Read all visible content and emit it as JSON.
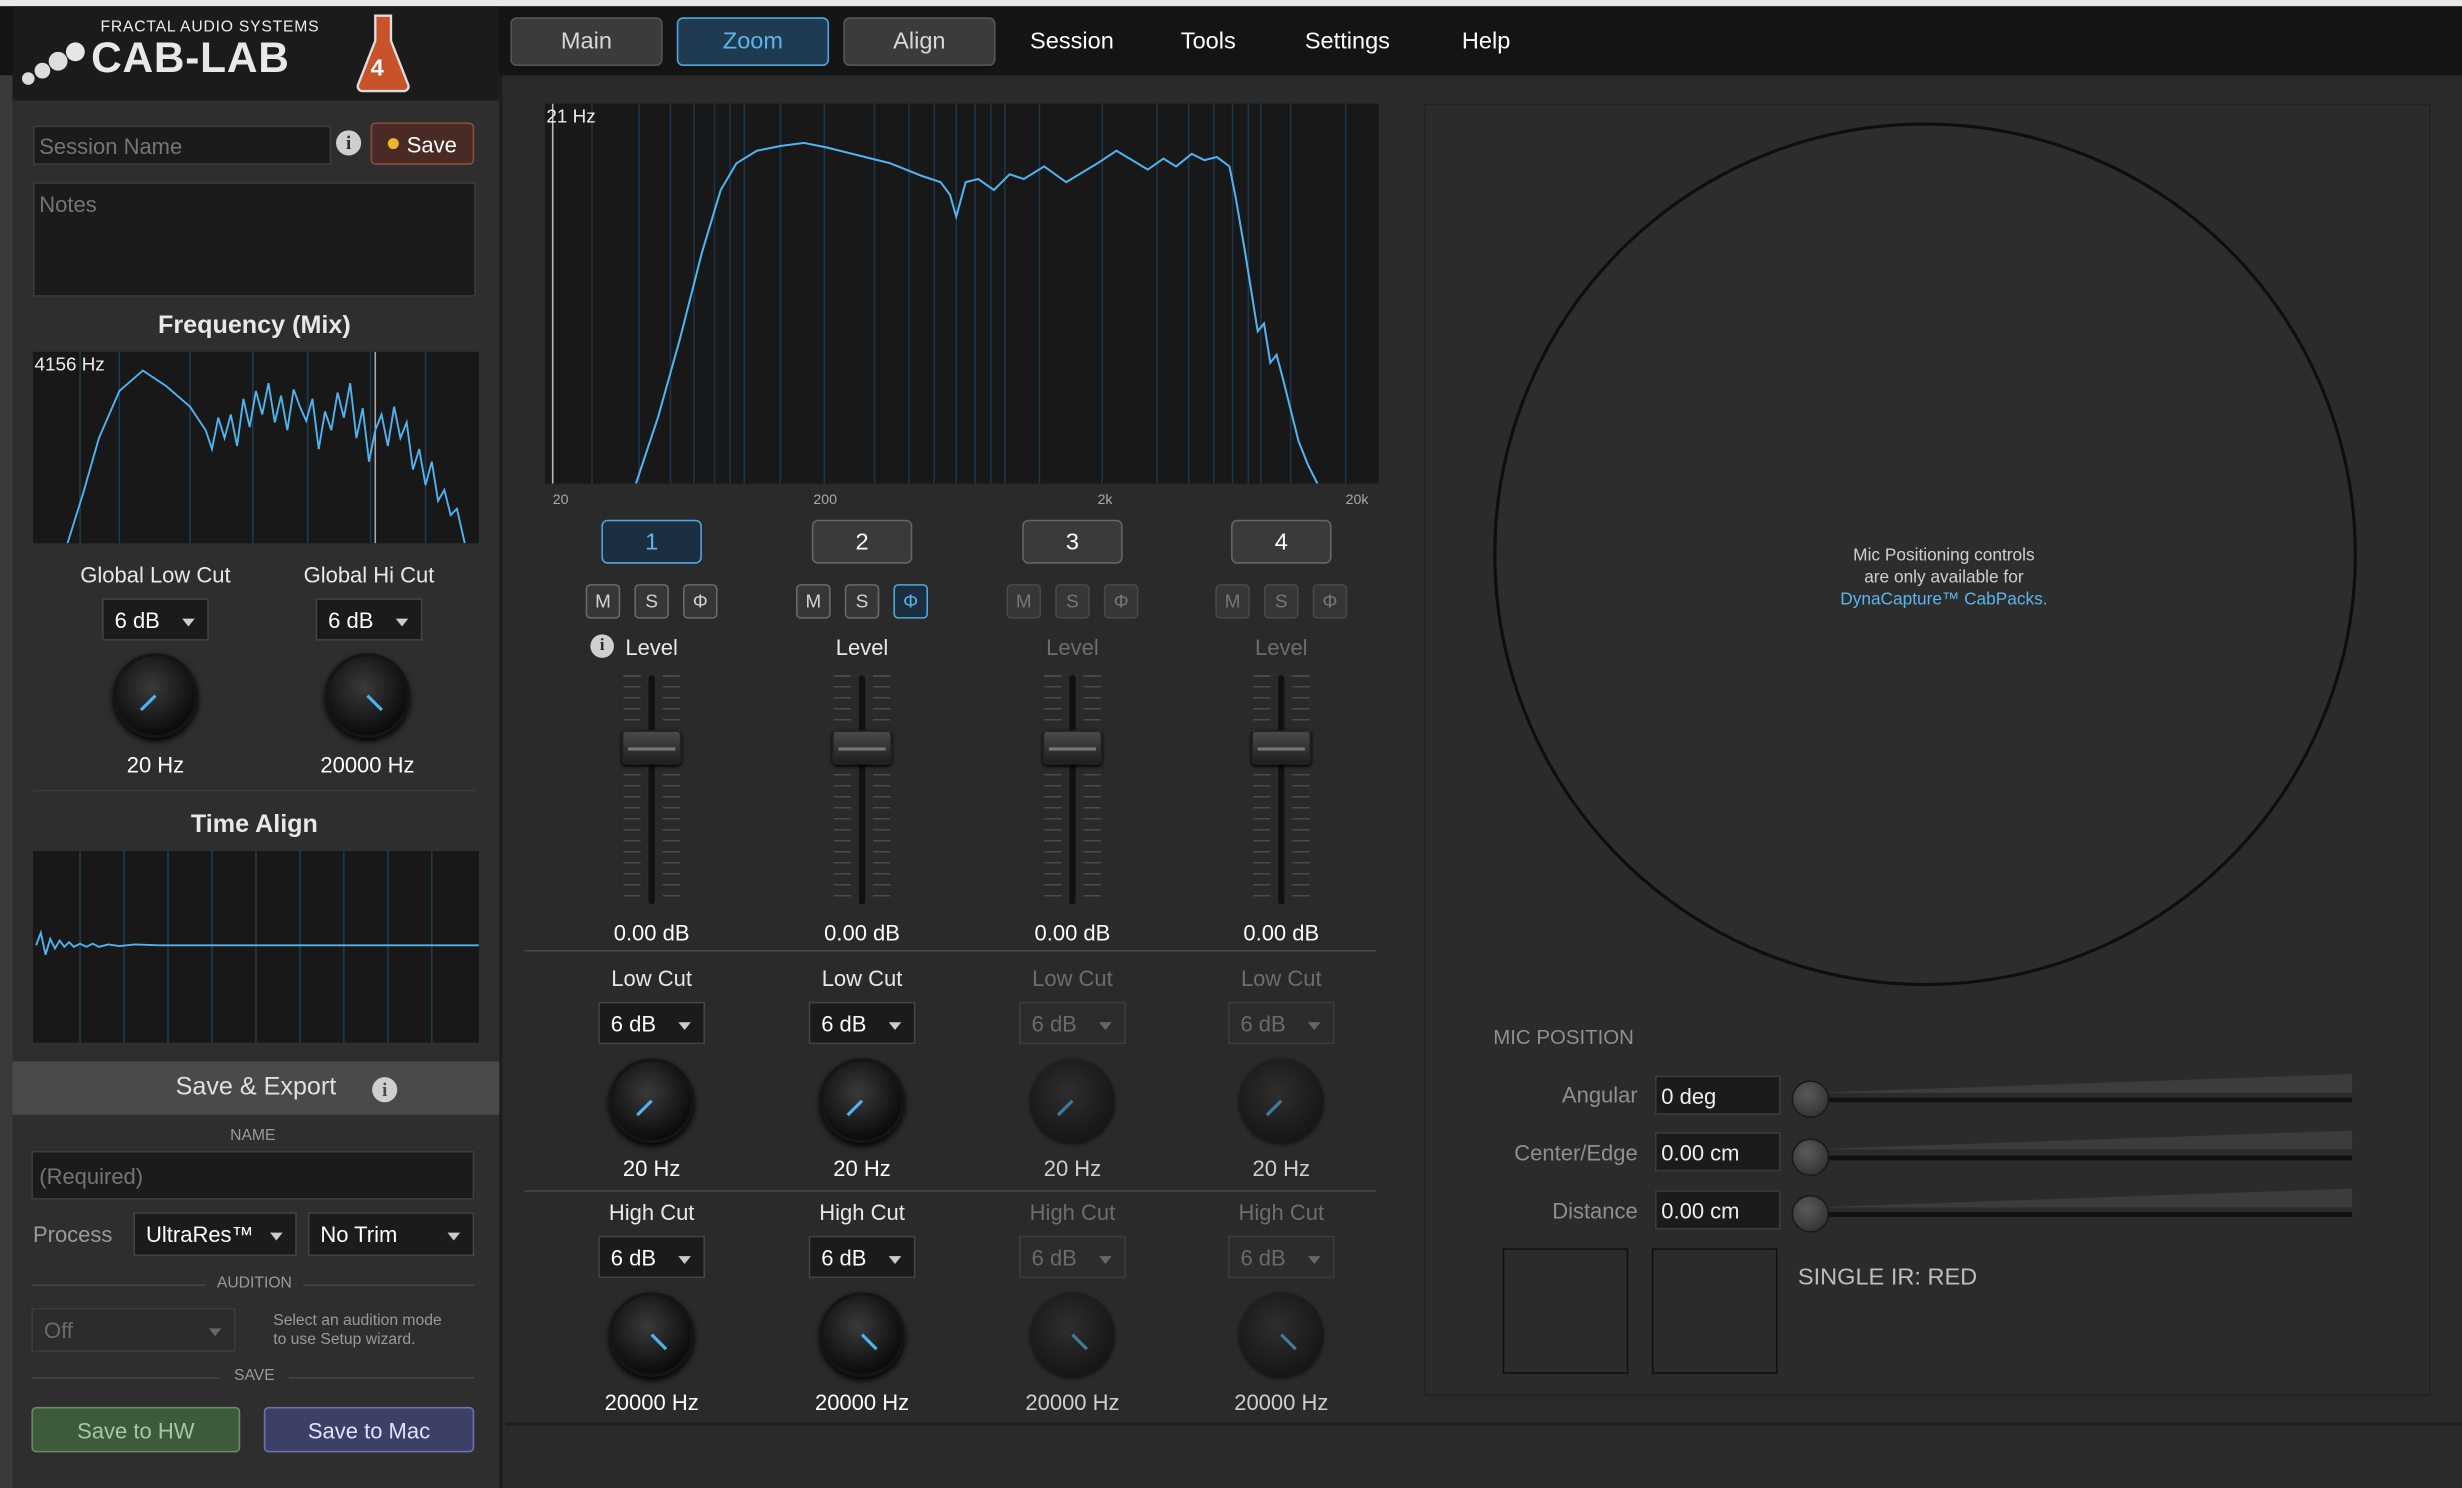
{
  "app": {
    "brand": "FRACTAL AUDIO SYSTEMS",
    "name": "CAB-LAB",
    "version": "4"
  },
  "nav": {
    "tabs": [
      {
        "label": "Main",
        "active": false
      },
      {
        "label": "Zoom",
        "active": true
      },
      {
        "label": "Align",
        "active": false
      }
    ],
    "menus": [
      "Session",
      "Tools",
      "Settings",
      "Help"
    ]
  },
  "session": {
    "name_placeholder": "Session Name",
    "save_label": "Save",
    "notes_placeholder": "Notes"
  },
  "frequency_mix": {
    "title": "Frequency (Mix)",
    "readout": "4156 Hz"
  },
  "global_low_cut": {
    "label": "Global Low Cut",
    "slope": "6 dB",
    "freq": "20 Hz"
  },
  "global_hi_cut": {
    "label": "Global Hi Cut",
    "slope": "6 dB",
    "freq": "20000 Hz"
  },
  "time_align": {
    "title": "Time Align"
  },
  "save_export": {
    "title": "Save & Export",
    "name_label": "NAME",
    "name_placeholder": "(Required)",
    "process_label": "Process",
    "process_value": "UltraRes™",
    "trim_value": "No Trim",
    "audition_label": "AUDITION",
    "audition_value": "Off",
    "audition_hint_1": "Select an audition mode",
    "audition_hint_2": "to use Setup wizard.",
    "save_label": "SAVE",
    "save_hw": "Save to HW",
    "save_mac": "Save to Mac"
  },
  "zoom_plot": {
    "readout": "21 Hz",
    "ticks": [
      "20",
      "200",
      "2k",
      "20k"
    ]
  },
  "channels": [
    {
      "number": "1",
      "active": true,
      "enabled": true,
      "mute": "M",
      "solo": "S",
      "phase": "Φ",
      "phase_on": false,
      "level_label": "Level",
      "level": "0.00 dB",
      "low_cut_label": "Low Cut",
      "low_cut_slope": "6 dB",
      "low_cut_freq": "20 Hz",
      "high_cut_label": "High Cut",
      "high_cut_slope": "6 dB",
      "high_cut_freq": "20000 Hz"
    },
    {
      "number": "2",
      "active": false,
      "enabled": true,
      "mute": "M",
      "solo": "S",
      "phase": "Φ",
      "phase_on": true,
      "level_label": "Level",
      "level": "0.00 dB",
      "low_cut_label": "Low Cut",
      "low_cut_slope": "6 dB",
      "low_cut_freq": "20 Hz",
      "high_cut_label": "High Cut",
      "high_cut_slope": "6 dB",
      "high_cut_freq": "20000 Hz"
    },
    {
      "number": "3",
      "active": false,
      "enabled": false,
      "mute": "M",
      "solo": "S",
      "phase": "Φ",
      "phase_on": false,
      "level_label": "Level",
      "level": "0.00 dB",
      "low_cut_label": "Low Cut",
      "low_cut_slope": "6 dB",
      "low_cut_freq": "20 Hz",
      "high_cut_label": "High Cut",
      "high_cut_slope": "6 dB",
      "high_cut_freq": "20000 Hz"
    },
    {
      "number": "4",
      "active": false,
      "enabled": false,
      "mute": "M",
      "solo": "S",
      "phase": "Φ",
      "phase_on": false,
      "level_label": "Level",
      "level": "0.00 dB",
      "low_cut_label": "Low Cut",
      "low_cut_slope": "6 dB",
      "low_cut_freq": "20 Hz",
      "high_cut_label": "High Cut",
      "high_cut_slope": "6 dB",
      "high_cut_freq": "20000 Hz"
    }
  ],
  "mic": {
    "message_1": "Mic Positioning controls",
    "message_2": "are only available for",
    "message_link": "DynaCapture™ CabPacks.",
    "section_title": "MIC POSITION",
    "angular_label": "Angular",
    "angular_value": "0 deg",
    "center_edge_label": "Center/Edge",
    "center_edge_value": "0.00 cm",
    "distance_label": "Distance",
    "distance_value": "0.00 cm",
    "single_ir": "SINGLE IR: RED"
  },
  "colors": {
    "accent": "#4fa8de",
    "save_dot": "#f0b429",
    "curve": "#4fb3ef"
  }
}
